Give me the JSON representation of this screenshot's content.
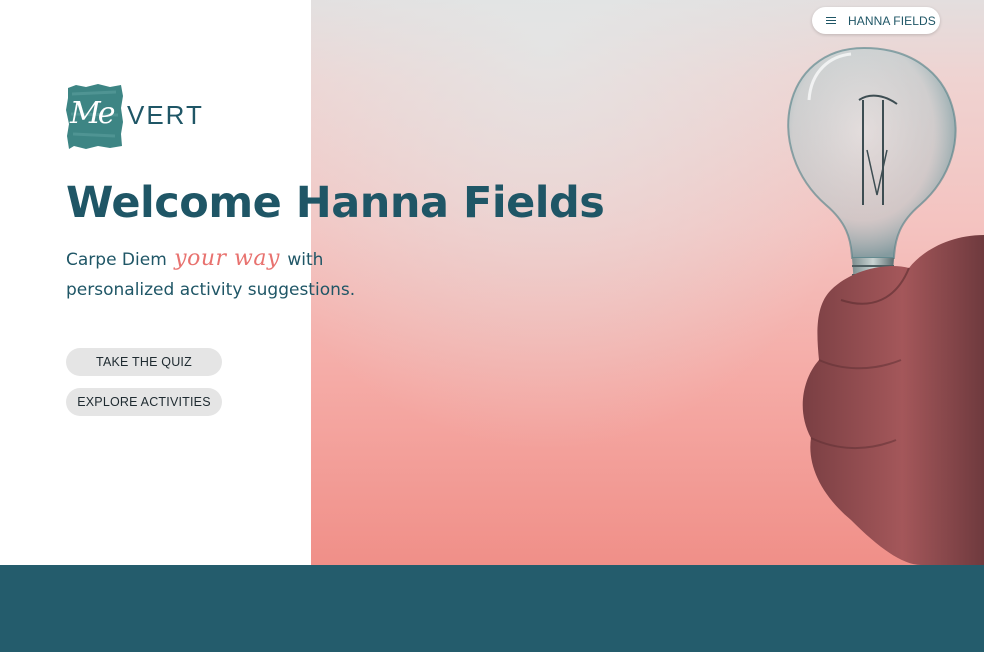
{
  "nav": {
    "user_name": "HANNA FIELDS",
    "menu_icon": "menu-icon"
  },
  "logo": {
    "script": "Me",
    "word": "VERT"
  },
  "hero": {
    "title": "Welcome Hanna Fields",
    "tagline_before": "Carpe Diem",
    "tagline_script": "your way",
    "tagline_after": "with personalized activity suggestions.",
    "image_subject": "hand-holding-light-bulb-image"
  },
  "actions": {
    "quiz_label": "TAKE THE QUIZ",
    "explore_label": "EXPLORE ACTIVITIES"
  },
  "colors": {
    "brand": "#1f5666",
    "accent_script": "#e8726f",
    "footer": "#245c6c",
    "button_bg": "#e5e5e5"
  }
}
